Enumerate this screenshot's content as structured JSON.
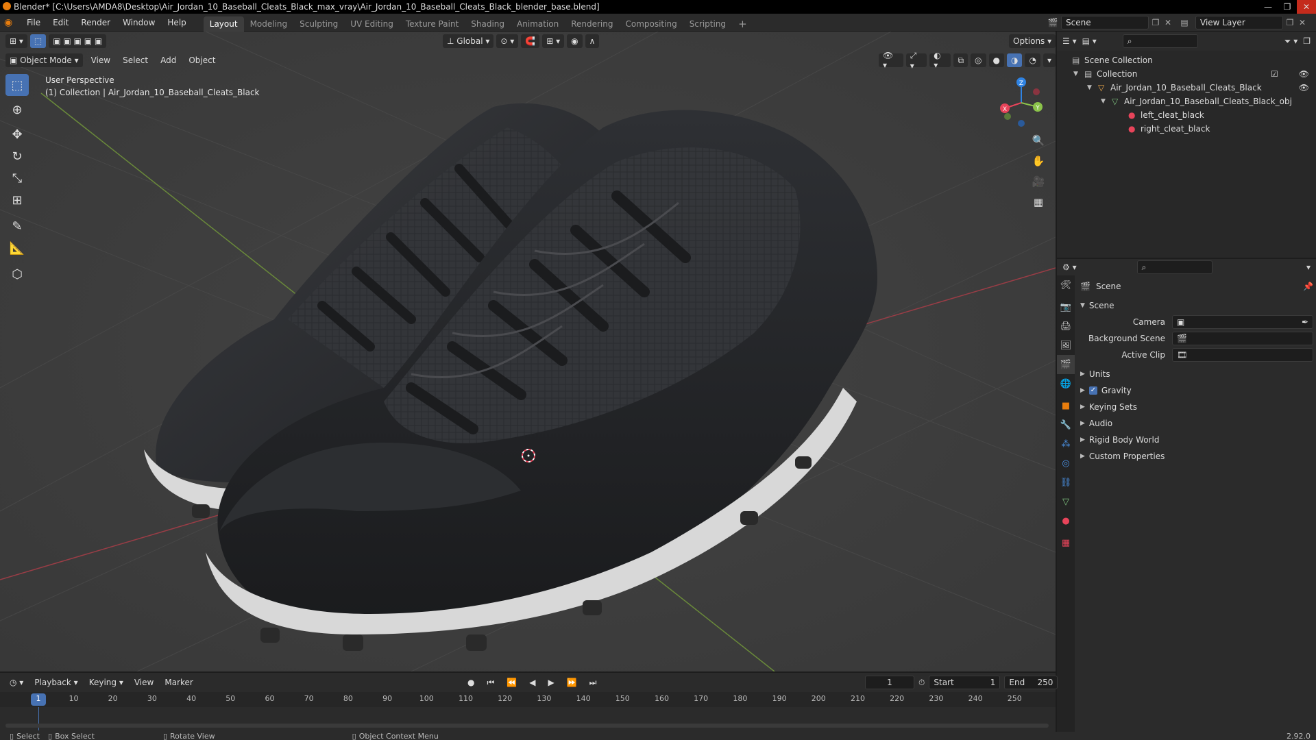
{
  "titlebar": {
    "title": "Blender* [C:\\Users\\AMDA8\\Desktop\\Air_Jordan_10_Baseball_Cleats_Black_max_vray\\Air_Jordan_10_Baseball_Cleats_Black_blender_base.blend]",
    "minimize": "—",
    "restore": "❐",
    "close": "✕"
  },
  "menubar": {
    "items": [
      "File",
      "Edit",
      "Render",
      "Window",
      "Help"
    ],
    "workspaces": [
      "Layout",
      "Modeling",
      "Sculpting",
      "UV Editing",
      "Texture Paint",
      "Shading",
      "Animation",
      "Rendering",
      "Compositing",
      "Scripting"
    ],
    "active_workspace": "Layout",
    "add_tab": "+",
    "scene": "Scene",
    "view_layer": "View Layer"
  },
  "viewport": {
    "header": {
      "mode": "Object Mode",
      "menus": [
        "View",
        "Select",
        "Add",
        "Object"
      ],
      "orientation": "Global",
      "options": "Options"
    },
    "overlay_text": {
      "perspective": "User Perspective",
      "collection": "(1) Collection | Air_Jordan_10_Baseball_Cleats_Black"
    },
    "gizmo": {
      "x": "X",
      "y": "Y",
      "z": "Z"
    }
  },
  "outliner": {
    "rows": [
      {
        "label": "Scene Collection",
        "indent": 0
      },
      {
        "label": "Collection",
        "indent": 1
      },
      {
        "label": "Air_Jordan_10_Baseball_Cleats_Black",
        "indent": 2
      },
      {
        "label": "Air_Jordan_10_Baseball_Cleats_Black_obj",
        "indent": 3
      },
      {
        "label": "left_cleat_black",
        "indent": 4
      },
      {
        "label": "right_cleat_black",
        "indent": 4
      }
    ]
  },
  "properties": {
    "context": "Scene",
    "panel_title": "Scene",
    "fields": [
      {
        "label": "Camera",
        "value": ""
      },
      {
        "label": "Background Scene",
        "value": ""
      },
      {
        "label": "Active Clip",
        "value": ""
      }
    ],
    "subpanels": [
      "Units",
      "Gravity",
      "Keying Sets",
      "Audio",
      "Rigid Body World",
      "Custom Properties"
    ],
    "gravity_checked": true
  },
  "timeline": {
    "menus": [
      "Playback",
      "Keying",
      "View",
      "Marker"
    ],
    "current_frame": "1",
    "start_label": "Start",
    "start": "1",
    "end_label": "End",
    "end": "250",
    "ticks": [
      "1",
      "10",
      "20",
      "30",
      "40",
      "50",
      "60",
      "70",
      "80",
      "90",
      "100",
      "110",
      "120",
      "130",
      "140",
      "150",
      "160",
      "170",
      "180",
      "190",
      "200",
      "210",
      "220",
      "230",
      "240",
      "250"
    ]
  },
  "statusbar": {
    "select": "Select",
    "box_select": "Box Select",
    "rotate_view": "Rotate View",
    "context_menu": "Object Context Menu",
    "version": "2.92.0"
  },
  "colors": {
    "accent": "#4772b3",
    "viewport_bg": "#3d3d3d",
    "panel_bg": "#2b2b2b",
    "x_axis": "#e8445a",
    "y_axis": "#8bc34a",
    "z_axis": "#2f83e3"
  }
}
